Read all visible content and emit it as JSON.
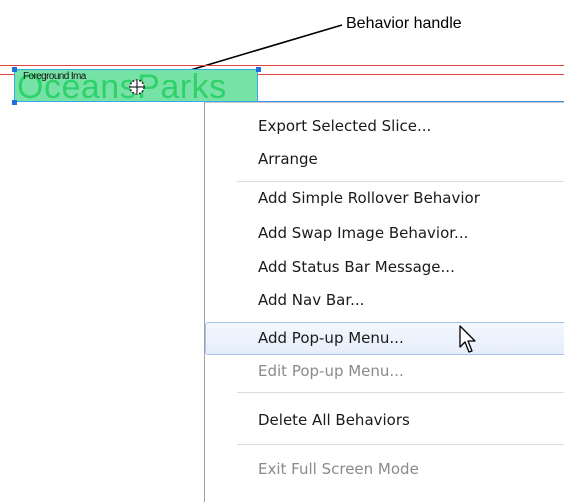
{
  "annotation": {
    "label": "Behavior handle"
  },
  "slice": {
    "text": "OceansParks",
    "label": "Foreground Ima"
  },
  "menu": {
    "items": [
      {
        "label": "Export Selected Slice...",
        "disabled": false
      },
      {
        "label": "Arrange",
        "disabled": false
      },
      {
        "label": "Add Simple Rollover Behavior",
        "disabled": false
      },
      {
        "label": "Add Swap Image Behavior...",
        "disabled": false
      },
      {
        "label": "Add Status Bar Message...",
        "disabled": false
      },
      {
        "label": "Add Nav Bar...",
        "disabled": false
      },
      {
        "label": "Add Pop-up Menu...",
        "disabled": false,
        "highlighted": true
      },
      {
        "label": "Edit Pop-up Menu...",
        "disabled": true
      },
      {
        "label": "Delete All Behaviors",
        "disabled": false
      },
      {
        "label": "Exit Full Screen Mode",
        "disabled": true
      }
    ]
  },
  "colors": {
    "slice_fill": "#77e2a6",
    "slice_text": "#2fd16b",
    "guide_red": "#e0443c",
    "guide_blue": "#3d8de0",
    "highlight_border": "#a9c3e8"
  },
  "icons": {
    "behavior_handle": "crosshair-circle-icon",
    "cursor": "mouse-pointer-icon"
  }
}
